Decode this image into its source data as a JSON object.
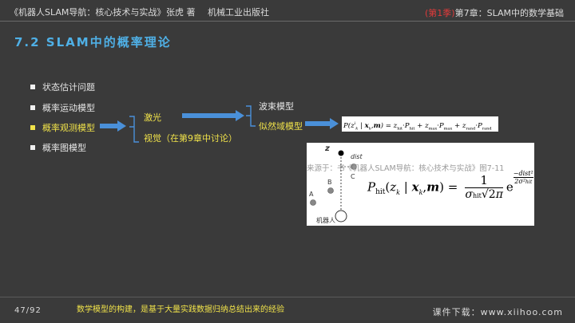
{
  "header": {
    "book_title": "《机器人SLAM导航：核心技术与实战》",
    "author": "张虎 著",
    "publisher": "机械工业出版社",
    "edition": "(第1季)",
    "chapter": "第7章：SLAM中的数学基础"
  },
  "section_title": "7.2 SLAM中的概率理论",
  "bullets": [
    {
      "label": "状态估计问题"
    },
    {
      "label": "概率运动模型"
    },
    {
      "label": "概率观测模型"
    },
    {
      "label": "概率图模型"
    }
  ],
  "branch1": {
    "laser": "激光",
    "vision": "视觉（在第9章中讨论）"
  },
  "branch2": {
    "beam": "波束模型",
    "likelihood": "似然域模型"
  },
  "figure": {
    "z_label": "z",
    "dist_label": "dist",
    "point_a": "A",
    "point_b": "B",
    "point_c": "C",
    "robot_label": "机器人",
    "source": "来源于：书《机器人SLAM导航：核心技术与实战》图7-11"
  },
  "footer": {
    "page": "47/92",
    "note": "数学模型的构建，是基于大量实践数据归纳总结出来的经验",
    "download": "课件下载：www.xiihoo.com"
  },
  "colors": {
    "background": "#3a3a3a",
    "accent_blue": "#4fb0e6",
    "highlight_yellow": "#f0e24a",
    "edition_red": "#e03a3a",
    "arrow_blue": "#4a90d9"
  }
}
